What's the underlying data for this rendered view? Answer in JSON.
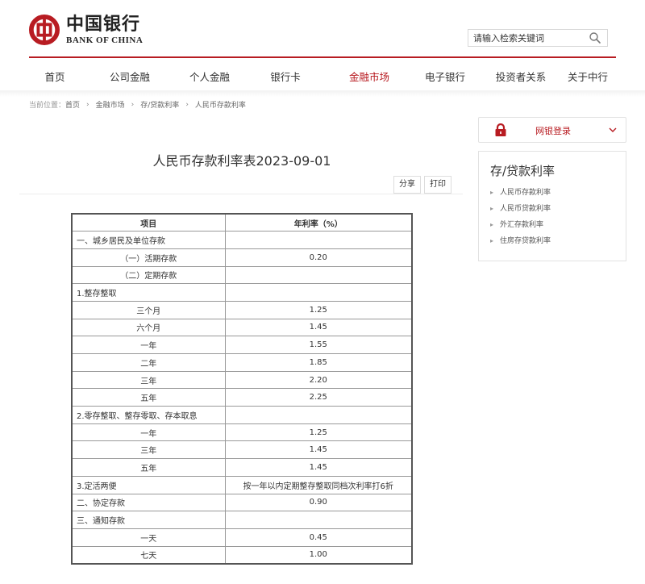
{
  "header": {
    "logo_cn": "中国银行",
    "logo_en": "BANK OF CHINA",
    "search_placeholder": "请输入检索关键词"
  },
  "nav": {
    "items": [
      {
        "label": "首页",
        "active": false
      },
      {
        "label": "公司金融",
        "active": false
      },
      {
        "label": "个人金融",
        "active": false
      },
      {
        "label": "银行卡",
        "active": false
      },
      {
        "label": "金融市场",
        "active": true
      },
      {
        "label": "电子银行",
        "active": false
      },
      {
        "label": "投资者关系",
        "active": false
      },
      {
        "label": "关于中行",
        "active": false
      }
    ]
  },
  "breadcrumb": {
    "prefix": "当前位置：",
    "items": [
      "首页",
      "金融市场",
      "存/贷款利率",
      "人民币存款利率"
    ]
  },
  "page": {
    "title": "人民币存款利率表2023-09-01",
    "share_label": "分享",
    "print_label": "打印"
  },
  "table": {
    "headers": [
      "项目",
      "年利率（%）"
    ],
    "rows": [
      {
        "item": "一、城乡居民及单位存款",
        "rate": "",
        "align": "left"
      },
      {
        "item": "（一）活期存款",
        "rate": "0.20",
        "align": "center"
      },
      {
        "item": "（二）定期存款",
        "rate": "",
        "align": "center"
      },
      {
        "item": "1.整存整取",
        "rate": "",
        "align": "left"
      },
      {
        "item": "三个月",
        "rate": "1.25",
        "align": "center"
      },
      {
        "item": "六个月",
        "rate": "1.45",
        "align": "center"
      },
      {
        "item": "一年",
        "rate": "1.55",
        "align": "center"
      },
      {
        "item": "二年",
        "rate": "1.85",
        "align": "center"
      },
      {
        "item": "三年",
        "rate": "2.20",
        "align": "center"
      },
      {
        "item": "五年",
        "rate": "2.25",
        "align": "center"
      },
      {
        "item": "2.零存整取、整存零取、存本取息",
        "rate": "",
        "align": "left"
      },
      {
        "item": "一年",
        "rate": "1.25",
        "align": "center"
      },
      {
        "item": "三年",
        "rate": "1.45",
        "align": "center"
      },
      {
        "item": "五年",
        "rate": "1.45",
        "align": "center"
      },
      {
        "item": "3.定活两便",
        "rate": "按一年以内定期整存整取同档次利率打6折",
        "align": "left"
      },
      {
        "item": "二、协定存款",
        "rate": "0.90",
        "align": "left"
      },
      {
        "item": "三、通知存款",
        "rate": "",
        "align": "left"
      },
      {
        "item": "一天",
        "rate": "0.45",
        "align": "center"
      },
      {
        "item": "七天",
        "rate": "1.00",
        "align": "center"
      }
    ]
  },
  "sidebar": {
    "login_label": "网银登录",
    "panel_title": "存/贷款利率",
    "links": [
      "人民币存款利率",
      "人民币贷款利率",
      "外汇存款利率",
      "住房存贷款利率"
    ]
  },
  "colors": {
    "brand_red": "#b81c22"
  }
}
